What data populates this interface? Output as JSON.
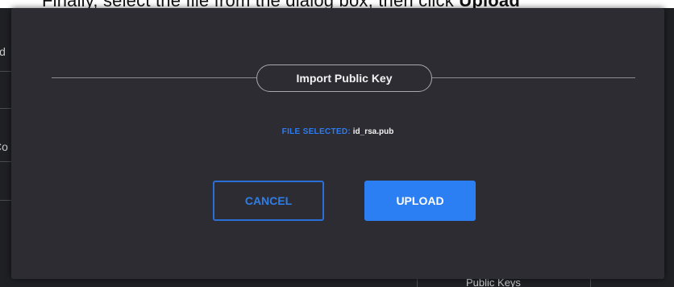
{
  "instruction": {
    "text_start": "Finally, select the file from the dialog box, then click ",
    "text_bold": "Upload"
  },
  "background": {
    "fragment_1": "ld",
    "fragment_2": "Co",
    "footer_tab": "Public Keys"
  },
  "modal": {
    "title": "Import Public Key",
    "file_selected_label": "FILE SELECTED:",
    "file_name": "id_rsa.pub",
    "cancel_label": "CANCEL",
    "upload_label": "UPLOAD"
  },
  "colors": {
    "modal_bg": "#2c2c32",
    "accent": "#2b7ff2",
    "label_blue": "#2d7cf0"
  }
}
